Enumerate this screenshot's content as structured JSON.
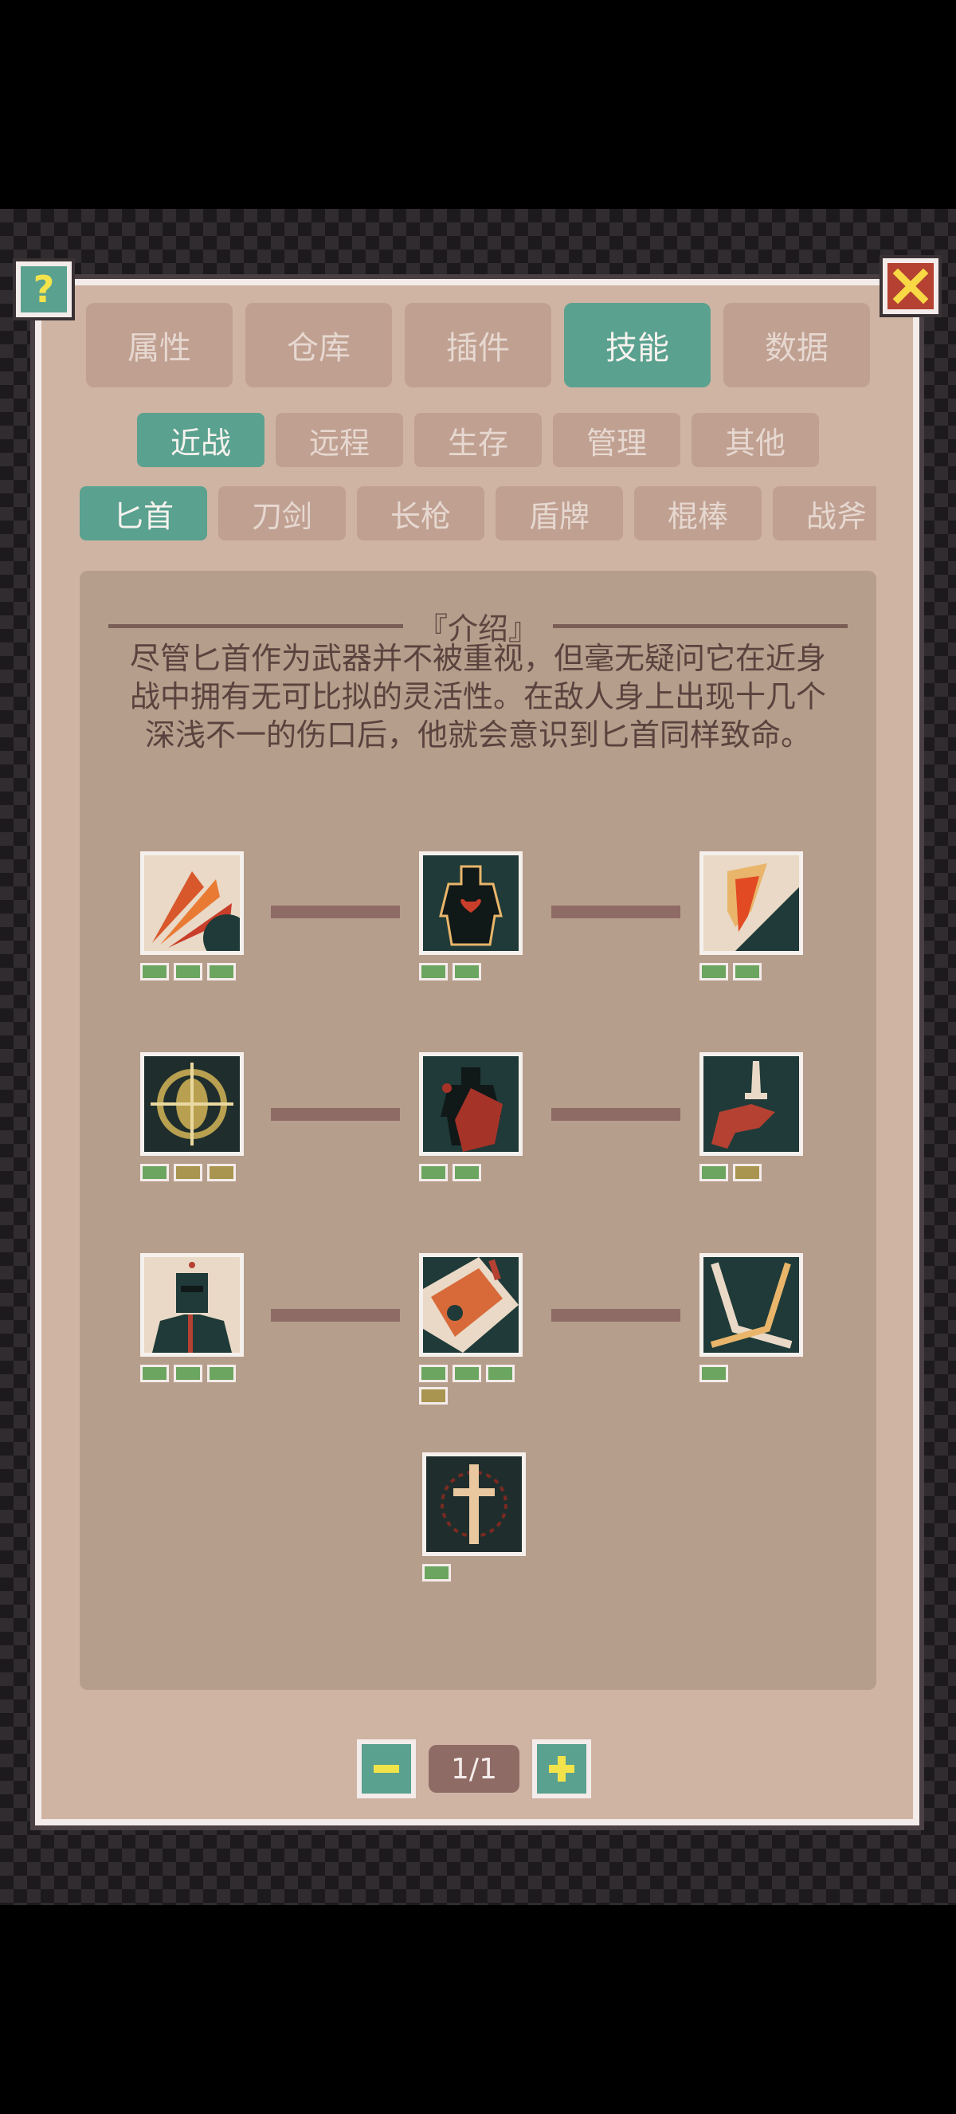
{
  "tabs": [
    {
      "label": "属性",
      "active": false
    },
    {
      "label": "仓库",
      "active": false
    },
    {
      "label": "插件",
      "active": false
    },
    {
      "label": "技能",
      "active": true
    },
    {
      "label": "数据",
      "active": false
    }
  ],
  "categories": [
    {
      "label": "近战",
      "active": true
    },
    {
      "label": "远程",
      "active": false
    },
    {
      "label": "生存",
      "active": false
    },
    {
      "label": "管理",
      "active": false
    },
    {
      "label": "其他",
      "active": false
    }
  ],
  "weapons": [
    {
      "label": "匕首",
      "active": true
    },
    {
      "label": "刀剑",
      "active": false
    },
    {
      "label": "长枪",
      "active": false
    },
    {
      "label": "盾牌",
      "active": false
    },
    {
      "label": "棍棒",
      "active": false
    },
    {
      "label": "战斧",
      "active": false
    }
  ],
  "intro": {
    "title": "『介绍』",
    "text": "尽管匕首作为武器并不被重视，但毫无疑问它在近身战中拥有无可比拟的灵活性。在敌人身上出现十几个深浅不一的伤口后，他就会意识到匕首同样致命。"
  },
  "skills": [
    {
      "icon": "claw-slash-icon",
      "pips": [
        "g",
        "g",
        "g"
      ]
    },
    {
      "icon": "heart-silhouette-icon",
      "pips": [
        "g",
        "g"
      ]
    },
    {
      "icon": "bleeding-hand-icon",
      "pips": [
        "g",
        "g"
      ]
    },
    {
      "icon": "crosshair-target-icon",
      "pips": [
        "g",
        "y",
        "y"
      ]
    },
    {
      "icon": "bloody-figure-icon",
      "pips": [
        "g",
        "g"
      ]
    },
    {
      "icon": "hand-dagger-icon",
      "pips": [
        "g",
        "y"
      ]
    },
    {
      "icon": "masked-assassin-icon",
      "pips": [
        "g",
        "g",
        "g"
      ]
    },
    {
      "icon": "dagger-strike-icon",
      "pips": [
        "g",
        "g",
        "g",
        "y"
      ]
    },
    {
      "icon": "crossed-blades-icon",
      "pips": [
        "g"
      ]
    },
    {
      "icon": "dagger-burst-icon",
      "pips": [
        "g"
      ]
    }
  ],
  "pager": {
    "label": "1/1",
    "minus": "−",
    "plus": "+"
  },
  "colors": {
    "accent": "#5aa18f",
    "panel": "#cfb4a3",
    "close": "#b44132",
    "pip_green": "#6ba55f",
    "pip_gold": "#a99450"
  }
}
